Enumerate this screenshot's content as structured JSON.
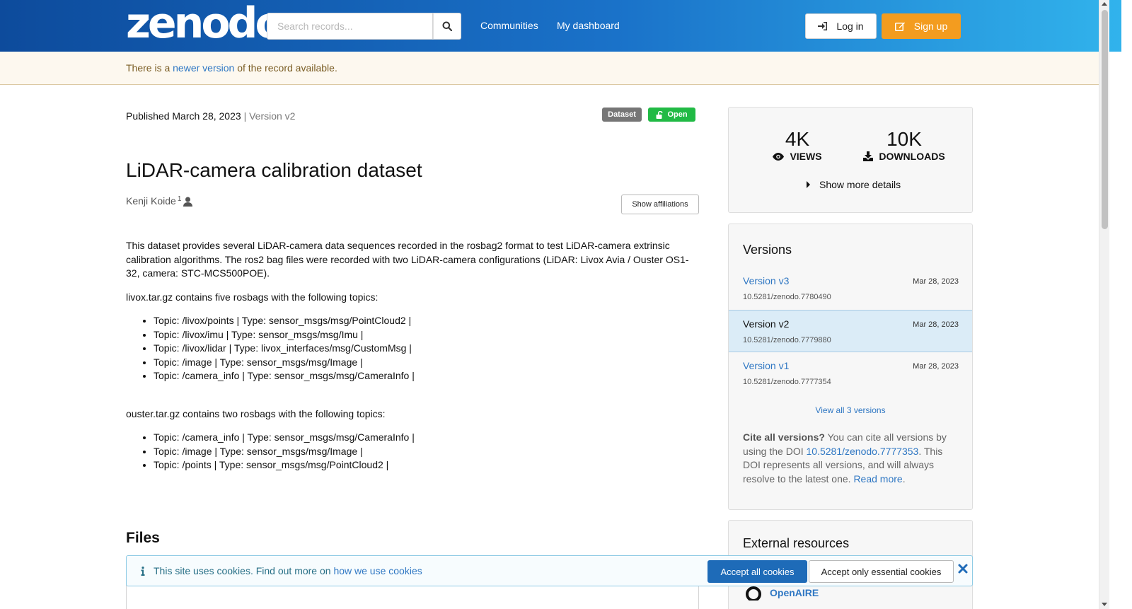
{
  "header": {
    "logo_text": "zenodo",
    "search_placeholder": "Search records...",
    "nav": [
      "Communities",
      "My dashboard"
    ],
    "login_label": "Log in",
    "signup_label": "Sign up"
  },
  "notice": {
    "prefix": "There is a",
    "link": "newer version",
    "suffix": "of the record available."
  },
  "record": {
    "published": "Published March 28, 2023",
    "version": "| Version v2",
    "badges": [
      "Dataset",
      "Open"
    ],
    "title": "LiDAR-camera calibration dataset",
    "author": "Kenji Koide",
    "author_sup": "1",
    "show_affiliations": "Show affiliations",
    "description": "This dataset provides several LiDAR-camera data sequences recorded in the rosbag2 format to test LiDAR-camera extrinsic calibration algorithms. The ros2 bag files were recorded with two LiDAR-camera configurations (LiDAR: Livox Avia / Ouster OS1-32, camera: STC-MCS500POE).",
    "livox_intro": "livox.tar.gz contains five rosbags with the following topics:",
    "livox_topics": [
      "Topic: /livox/points | Type: sensor_msgs/msg/PointCloud2 |",
      "Topic: /livox/imu | Type: sensor_msgs/msg/Imu |",
      "Topic: /livox/lidar | Type: livox_interfaces/msg/CustomMsg |",
      "Topic: /image | Type: sensor_msgs/msg/Image |",
      "Topic: /camera_info | Type: sensor_msgs/msg/CameraInfo |"
    ],
    "ouster_intro": "ouster.tar.gz contains two rosbags with the following topics:",
    "ouster_topics": [
      "Topic: /camera_info | Type: sensor_msgs/msg/CameraInfo |",
      "Topic: /image | Type: sensor_msgs/msg/Image |",
      "Topic: /points | Type: sensor_msgs/msg/PointCloud2 |"
    ],
    "files_title": "Files"
  },
  "stats": {
    "views_num": "4K",
    "views_label": "VIEWS",
    "downloads_num": "10K",
    "downloads_label": "DOWNLOADS",
    "more_details": "Show more details"
  },
  "versions": {
    "title": "Versions",
    "items": [
      {
        "name": "Version v3",
        "date": "Mar 28, 2023",
        "doi": "10.5281/zenodo.7780490"
      },
      {
        "name": "Version v2",
        "date": "Mar 28, 2023",
        "doi": "10.5281/zenodo.7779880"
      },
      {
        "name": "Version v1",
        "date": "Mar 28, 2023",
        "doi": "10.5281/zenodo.7777354"
      }
    ],
    "view_all": "View all 3 versions",
    "cite_bold": "Cite all versions?",
    "cite_text1": " You can cite all versions by using the DOI ",
    "cite_doi": "10.5281/zenodo.7777353",
    "cite_text2": ". This DOI represents all versions, and will always resolve to the latest one. ",
    "cite_read_more": "Read more",
    "cite_end": "."
  },
  "external": {
    "title": "External resources",
    "openaire": "OpenAIRE"
  },
  "cookie": {
    "text": "This site uses cookies. Find out more on",
    "link": "how we use cookies",
    "accept_all": "Accept all cookies",
    "accept_essential": "Accept only essential cookies"
  },
  "colors": {
    "header_start": "#0d4b9c",
    "header_end": "#31b3ec",
    "signup": "#f39c1f",
    "open_badge": "#21ba45",
    "link": "#2f77c3"
  },
  "icons": [
    "search-icon",
    "login-icon",
    "edit-icon",
    "unlock-icon",
    "user-icon",
    "eye-icon",
    "download-icon",
    "caret-right-icon",
    "info-icon",
    "close-icon",
    "openaire-icon"
  ]
}
